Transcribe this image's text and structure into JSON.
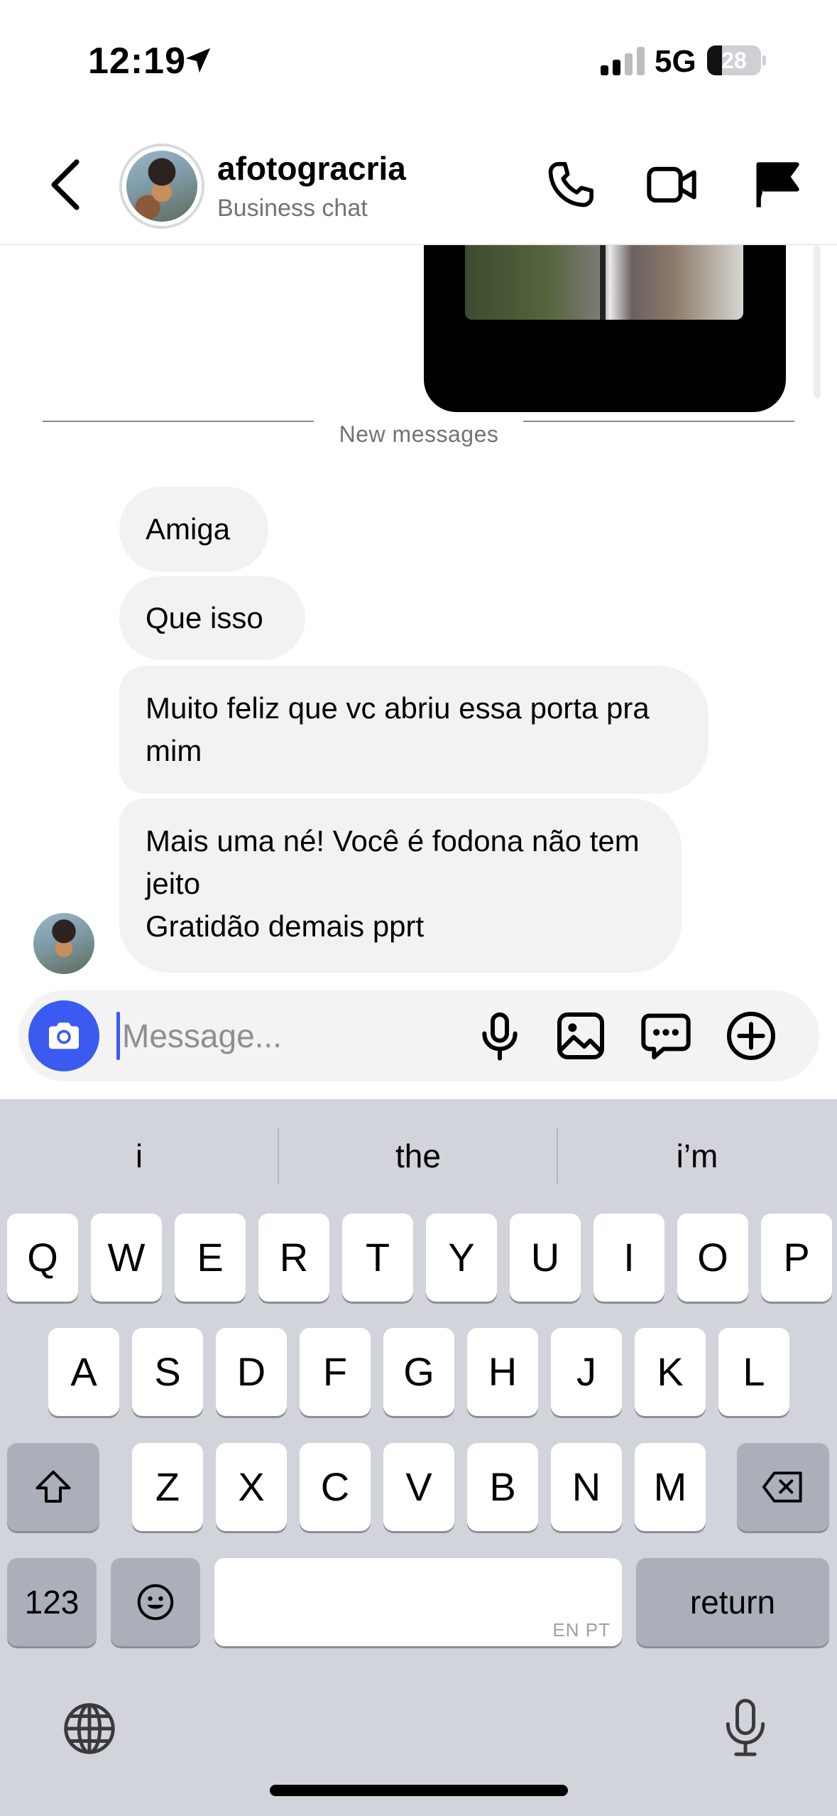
{
  "status_bar": {
    "time": "12:19",
    "network": "5G",
    "battery": "28",
    "battery_level": 0.28
  },
  "header": {
    "contact_name": "afotogracria",
    "subtitle": "Business chat"
  },
  "chat": {
    "divider_label": "New messages",
    "messages": [
      "Amiga",
      "Que isso",
      "Muito feliz que vc abriu essa porta pra mim",
      "Mais uma né! Você é fodona não tem jeito\nGratidão demais pprt"
    ]
  },
  "composer": {
    "placeholder": "Message..."
  },
  "keyboard": {
    "suggestions": [
      "i",
      "the",
      "i’m"
    ],
    "row1": [
      "Q",
      "W",
      "E",
      "R",
      "T",
      "Y",
      "U",
      "I",
      "O",
      "P"
    ],
    "row2": [
      "A",
      "S",
      "D",
      "F",
      "G",
      "H",
      "J",
      "K",
      "L"
    ],
    "row3": [
      "Z",
      "X",
      "C",
      "V",
      "B",
      "N",
      "M"
    ],
    "numbers_key": "123",
    "return_key": "return",
    "space_hint": "EN PT"
  },
  "colors": {
    "accent": "#3b5bf0",
    "bubble": "#f1f2f4",
    "keyboard_bg": "#d2d4db"
  },
  "icons": [
    "location-arrow-icon",
    "signal-icon",
    "back-chevron-icon",
    "phone-icon",
    "video-icon",
    "flag-icon",
    "camera-icon",
    "microphone-icon",
    "gallery-icon",
    "sticker-chat-icon",
    "plus-circle-icon",
    "shift-icon",
    "backspace-icon",
    "emoji-icon",
    "globe-icon",
    "dictation-mic-icon"
  ]
}
